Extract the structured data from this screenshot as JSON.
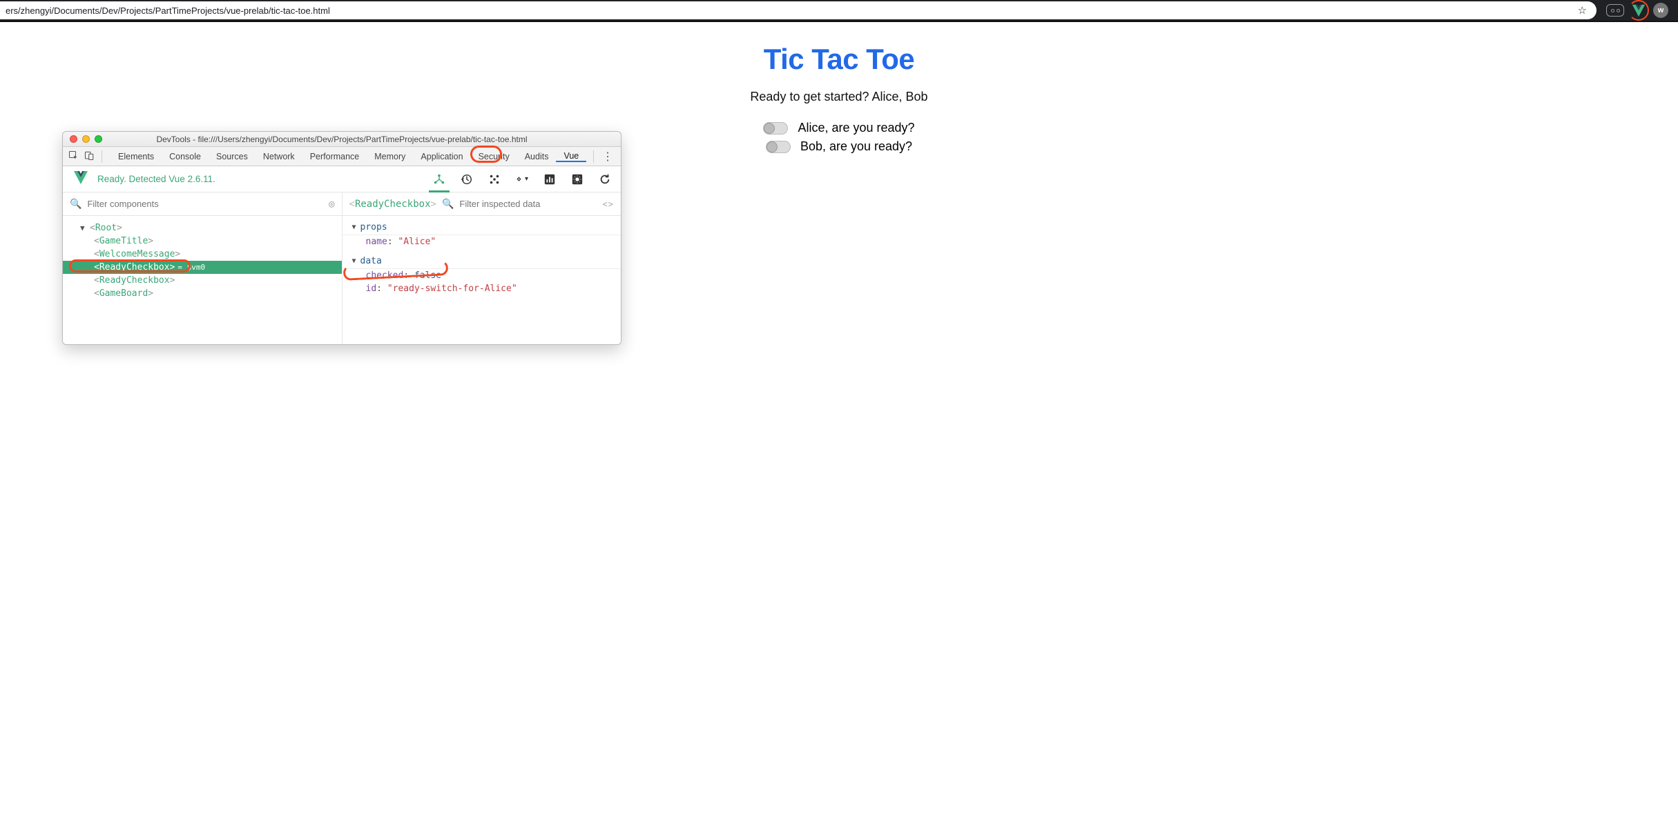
{
  "browser": {
    "url_visible": "ers/zhengyi/Documents/Dev/Projects/PartTimeProjects/vue-prelab/tic-tac-toe.html",
    "ext_wiki": "w"
  },
  "page": {
    "title": "Tic Tac Toe",
    "subtitle": "Ready to get started? Alice, Bob",
    "ready_alice": "Alice, are you ready?",
    "ready_bob": "Bob, are you ready?"
  },
  "devtools": {
    "title": "DevTools - file:///Users/zhengyi/Documents/Dev/Projects/PartTimeProjects/vue-prelab/tic-tac-toe.html",
    "tabs": [
      "Elements",
      "Console",
      "Sources",
      "Network",
      "Performance",
      "Memory",
      "Application",
      "Security",
      "Audits",
      "Vue"
    ],
    "active_tab": "Vue",
    "ready_status": "Ready. Detected Vue 2.6.11.",
    "left_filter_placeholder": "Filter components",
    "right_filter_placeholder": "Filter inspected data",
    "tree": {
      "root": "Root",
      "c1": "GameTitle",
      "c2": "WelcomeMessage",
      "c3": "ReadyCheckbox",
      "c3_vm": " = $vm0",
      "c4": "ReadyCheckbox",
      "c5": "GameBoard"
    },
    "crumb": "ReadyCheckbox",
    "inspector": {
      "props_head": "props",
      "prop_name_k": "name",
      "prop_name_v": "\"Alice\"",
      "data_head": "data",
      "data_checked_k": "checked",
      "data_checked_v": "false",
      "data_id_k": "id",
      "data_id_v": "\"ready-switch-for-Alice\""
    }
  }
}
